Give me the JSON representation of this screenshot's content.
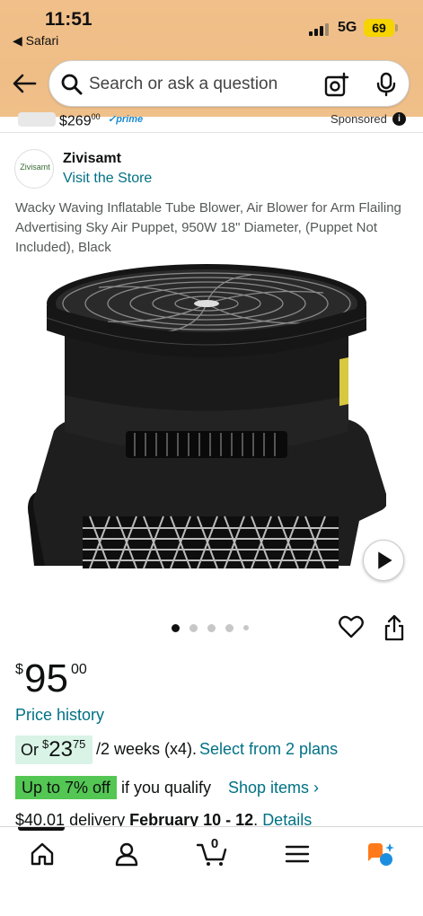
{
  "status_bar": {
    "time": "11:51",
    "back_app": "◀ Safari",
    "network": "5G",
    "battery": "69"
  },
  "search": {
    "placeholder": "Search or ask a question"
  },
  "sponsored_strip": {
    "price_whole": "$269",
    "price_frac": "00",
    "prime": "✓prime",
    "label": "Sponsored"
  },
  "brand": {
    "logo_text": "Zivisamt",
    "name": "Zivisamt",
    "visit_store": "Visit the Store"
  },
  "product": {
    "title": "Wacky Waving Inflatable Tube Blower, Air Blower for Arm Flailing Advertising Sky Air Puppet, 950W 18\" Diameter, (Puppet Not Included), Black",
    "image_count": 5,
    "active_image": 1
  },
  "price": {
    "currency": "$",
    "whole": "95",
    "fraction": "00",
    "history_link": "Price history"
  },
  "installment": {
    "or": "Or",
    "currency": "$",
    "amount_whole": "23",
    "amount_frac": "75",
    "terms": "/2 weeks (x4).",
    "link": "Select from 2 plans"
  },
  "promo": {
    "badge": "Up to 7% off",
    "text": "if you qualify",
    "link": "Shop items ›"
  },
  "delivery": {
    "fee": "$40.01",
    "label": " delivery ",
    "dates": "February 10 - 12",
    "sep": ". ",
    "details": "Details"
  },
  "bottom_nav": {
    "cart_count": "0",
    "items": [
      "home-icon",
      "account-icon",
      "cart-icon",
      "menu-icon",
      "ai-assistant-icon"
    ]
  },
  "colors": {
    "header": "#efbd86",
    "link": "#007185",
    "promo_green": "#53c653",
    "installment_bg": "#d9f3e6"
  }
}
